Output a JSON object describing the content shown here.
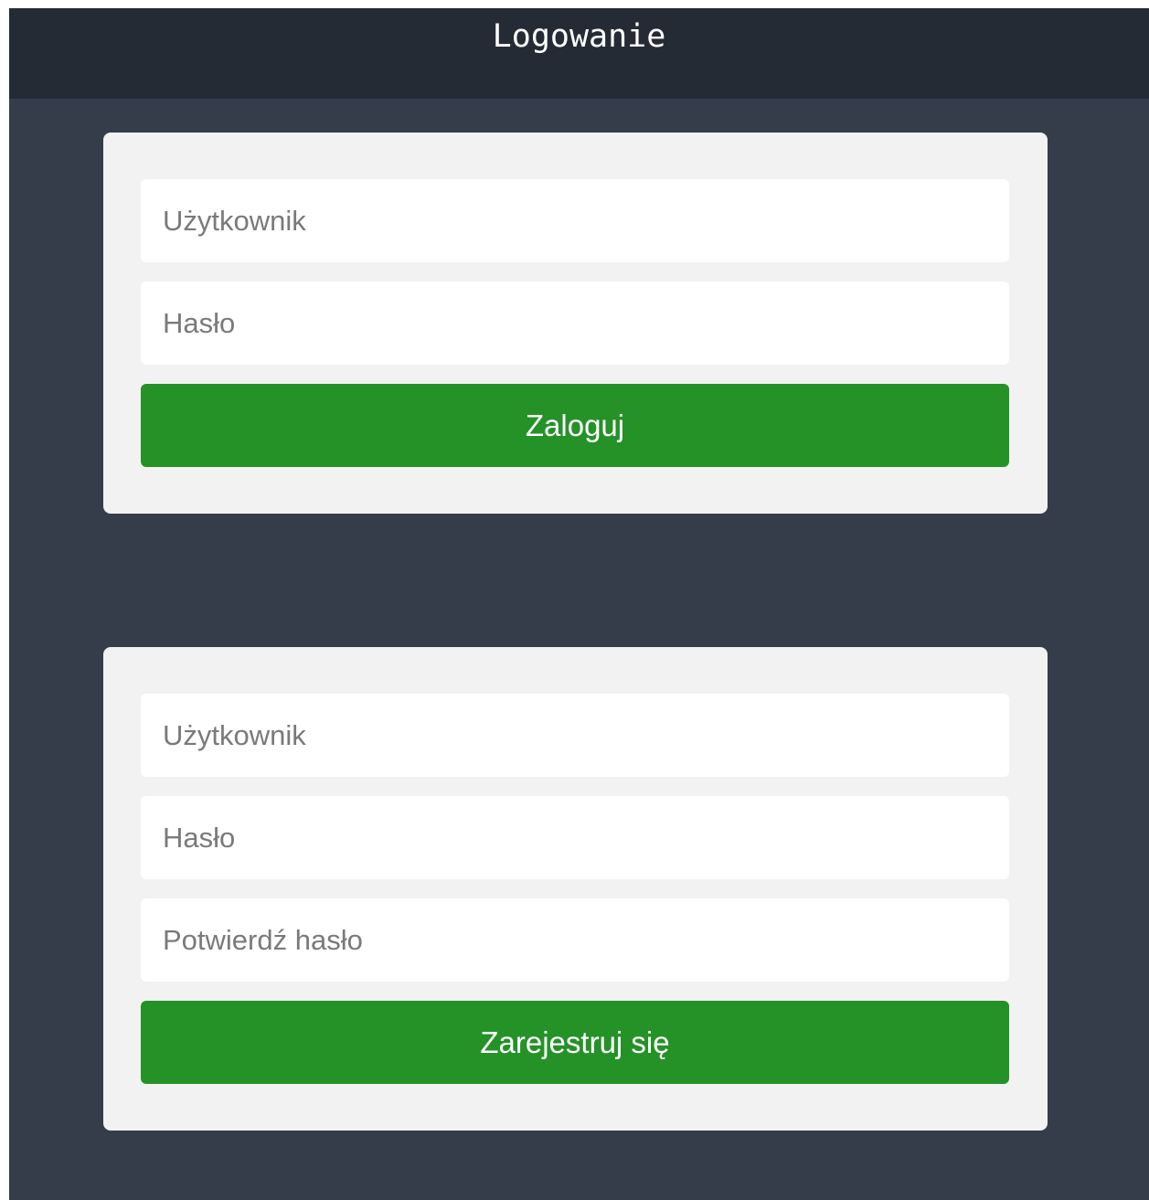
{
  "header": {
    "title": "Logowanie"
  },
  "login_form": {
    "username_placeholder": "Użytkownik",
    "password_placeholder": "Hasło",
    "submit_label": "Zaloguj"
  },
  "register_form": {
    "username_placeholder": "Użytkownik",
    "password_placeholder": "Hasło",
    "confirm_password_placeholder": "Potwierdź hasło",
    "submit_label": "Zarejestruj się"
  },
  "colors": {
    "page_background": "#343d49",
    "header_background": "#252b35",
    "card_background": "#f2f2f2",
    "button_green": "#259228"
  }
}
